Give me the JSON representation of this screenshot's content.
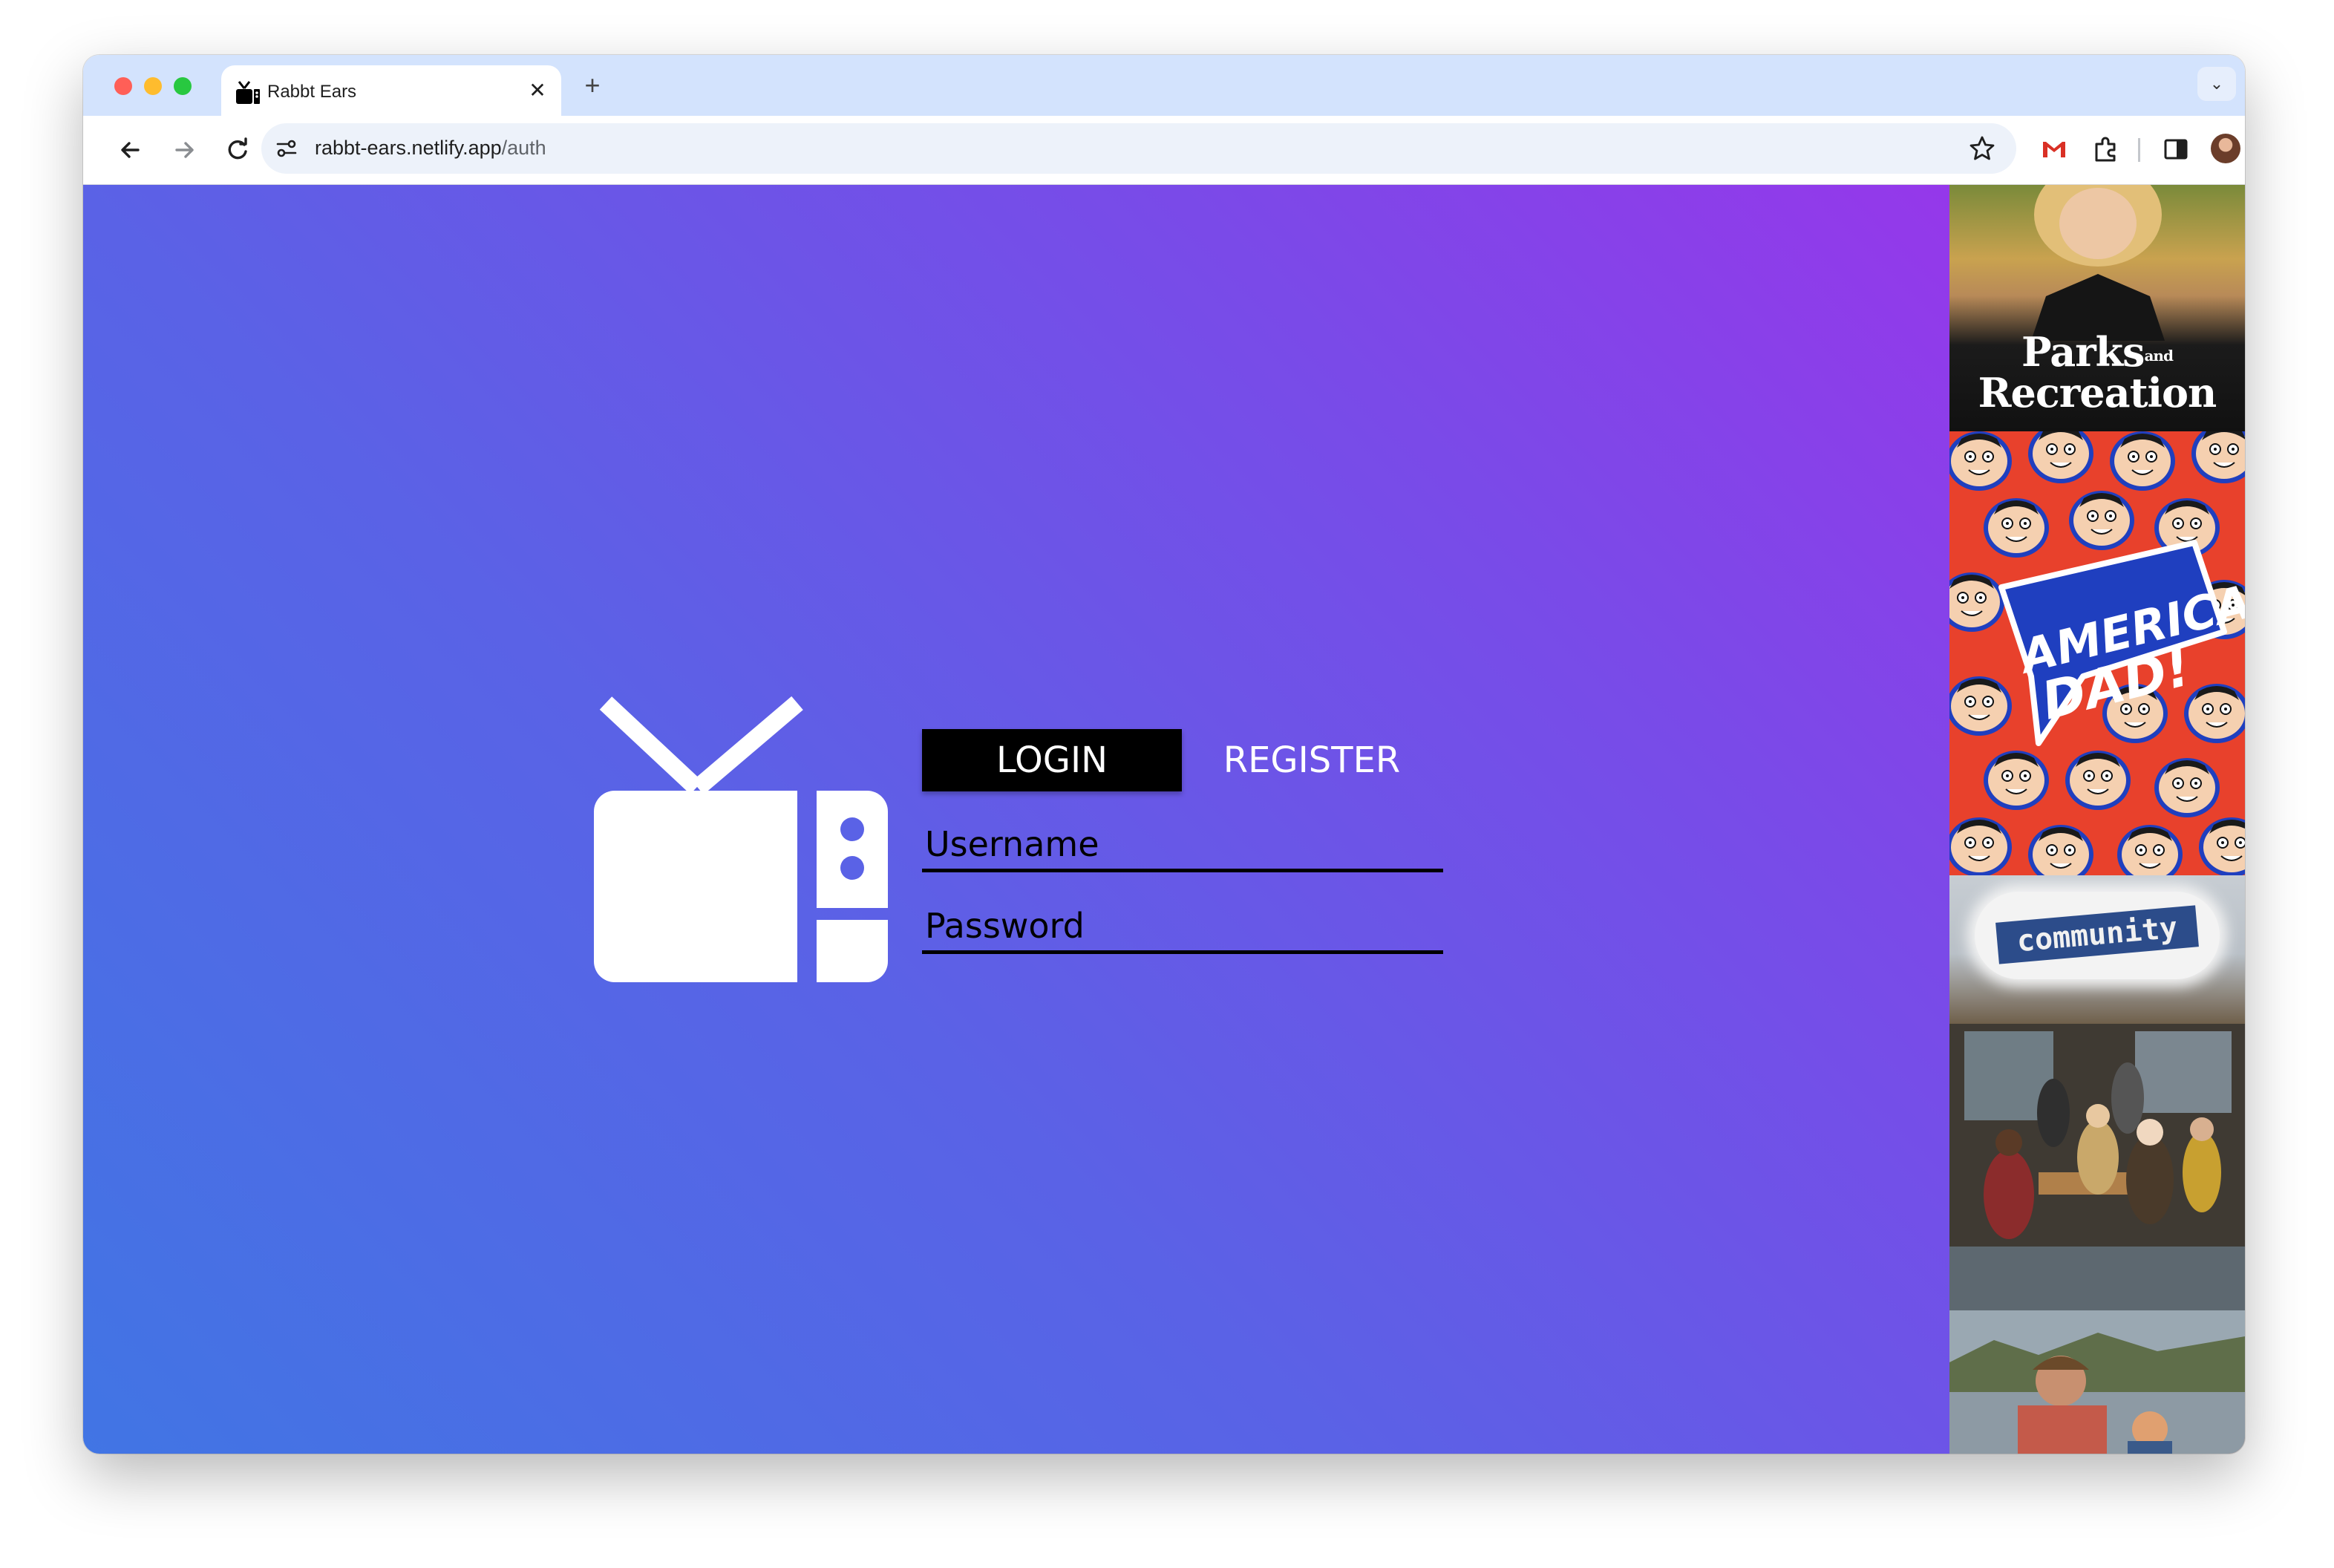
{
  "browser": {
    "tab_title": "Rabbt Ears",
    "tab_close": "✕",
    "new_tab": "+",
    "tab_search": "⌄",
    "url_host": "rabbt-ears.netlify.app",
    "url_path": "/auth"
  },
  "auth": {
    "login_tab": "LOGIN",
    "register_tab": "REGISTER",
    "username_placeholder": "Username",
    "password_placeholder": "Password"
  },
  "posters": {
    "parks_title_line1": "Parks",
    "parks_title_and": "and",
    "parks_title_line2": "Recreation",
    "american_dad_line1": "AMERICAN",
    "american_dad_line2": "DAD!",
    "community_title": "community"
  },
  "colors": {
    "gradient_start": "#4175e4",
    "gradient_end": "#9538ea",
    "login_tab_bg": "#000000"
  }
}
